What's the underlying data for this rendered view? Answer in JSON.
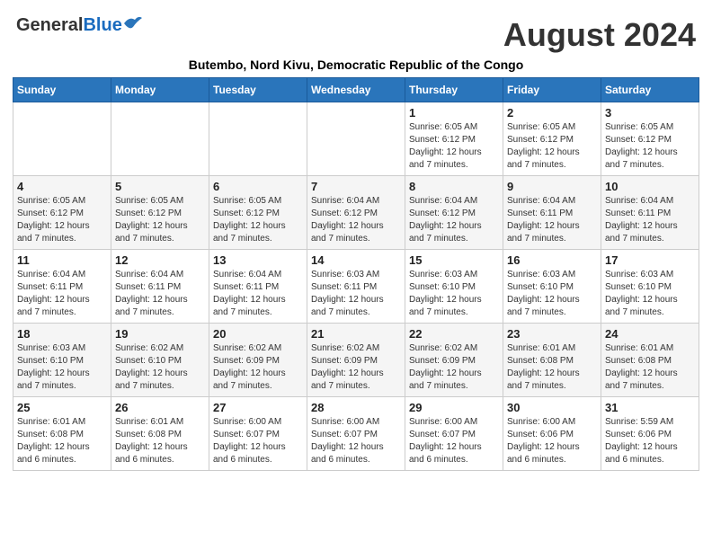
{
  "header": {
    "logo_general": "General",
    "logo_blue": "Blue",
    "month_year": "August 2024",
    "location": "Butembo, Nord Kivu, Democratic Republic of the Congo"
  },
  "days_of_week": [
    "Sunday",
    "Monday",
    "Tuesday",
    "Wednesday",
    "Thursday",
    "Friday",
    "Saturday"
  ],
  "weeks": [
    [
      {
        "day": "",
        "info": ""
      },
      {
        "day": "",
        "info": ""
      },
      {
        "day": "",
        "info": ""
      },
      {
        "day": "",
        "info": ""
      },
      {
        "day": "1",
        "info": "Sunrise: 6:05 AM\nSunset: 6:12 PM\nDaylight: 12 hours\nand 7 minutes."
      },
      {
        "day": "2",
        "info": "Sunrise: 6:05 AM\nSunset: 6:12 PM\nDaylight: 12 hours\nand 7 minutes."
      },
      {
        "day": "3",
        "info": "Sunrise: 6:05 AM\nSunset: 6:12 PM\nDaylight: 12 hours\nand 7 minutes."
      }
    ],
    [
      {
        "day": "4",
        "info": "Sunrise: 6:05 AM\nSunset: 6:12 PM\nDaylight: 12 hours\nand 7 minutes."
      },
      {
        "day": "5",
        "info": "Sunrise: 6:05 AM\nSunset: 6:12 PM\nDaylight: 12 hours\nand 7 minutes."
      },
      {
        "day": "6",
        "info": "Sunrise: 6:05 AM\nSunset: 6:12 PM\nDaylight: 12 hours\nand 7 minutes."
      },
      {
        "day": "7",
        "info": "Sunrise: 6:04 AM\nSunset: 6:12 PM\nDaylight: 12 hours\nand 7 minutes."
      },
      {
        "day": "8",
        "info": "Sunrise: 6:04 AM\nSunset: 6:12 PM\nDaylight: 12 hours\nand 7 minutes."
      },
      {
        "day": "9",
        "info": "Sunrise: 6:04 AM\nSunset: 6:11 PM\nDaylight: 12 hours\nand 7 minutes."
      },
      {
        "day": "10",
        "info": "Sunrise: 6:04 AM\nSunset: 6:11 PM\nDaylight: 12 hours\nand 7 minutes."
      }
    ],
    [
      {
        "day": "11",
        "info": "Sunrise: 6:04 AM\nSunset: 6:11 PM\nDaylight: 12 hours\nand 7 minutes."
      },
      {
        "day": "12",
        "info": "Sunrise: 6:04 AM\nSunset: 6:11 PM\nDaylight: 12 hours\nand 7 minutes."
      },
      {
        "day": "13",
        "info": "Sunrise: 6:04 AM\nSunset: 6:11 PM\nDaylight: 12 hours\nand 7 minutes."
      },
      {
        "day": "14",
        "info": "Sunrise: 6:03 AM\nSunset: 6:11 PM\nDaylight: 12 hours\nand 7 minutes."
      },
      {
        "day": "15",
        "info": "Sunrise: 6:03 AM\nSunset: 6:10 PM\nDaylight: 12 hours\nand 7 minutes."
      },
      {
        "day": "16",
        "info": "Sunrise: 6:03 AM\nSunset: 6:10 PM\nDaylight: 12 hours\nand 7 minutes."
      },
      {
        "day": "17",
        "info": "Sunrise: 6:03 AM\nSunset: 6:10 PM\nDaylight: 12 hours\nand 7 minutes."
      }
    ],
    [
      {
        "day": "18",
        "info": "Sunrise: 6:03 AM\nSunset: 6:10 PM\nDaylight: 12 hours\nand 7 minutes."
      },
      {
        "day": "19",
        "info": "Sunrise: 6:02 AM\nSunset: 6:10 PM\nDaylight: 12 hours\nand 7 minutes."
      },
      {
        "day": "20",
        "info": "Sunrise: 6:02 AM\nSunset: 6:09 PM\nDaylight: 12 hours\nand 7 minutes."
      },
      {
        "day": "21",
        "info": "Sunrise: 6:02 AM\nSunset: 6:09 PM\nDaylight: 12 hours\nand 7 minutes."
      },
      {
        "day": "22",
        "info": "Sunrise: 6:02 AM\nSunset: 6:09 PM\nDaylight: 12 hours\nand 7 minutes."
      },
      {
        "day": "23",
        "info": "Sunrise: 6:01 AM\nSunset: 6:08 PM\nDaylight: 12 hours\nand 7 minutes."
      },
      {
        "day": "24",
        "info": "Sunrise: 6:01 AM\nSunset: 6:08 PM\nDaylight: 12 hours\nand 7 minutes."
      }
    ],
    [
      {
        "day": "25",
        "info": "Sunrise: 6:01 AM\nSunset: 6:08 PM\nDaylight: 12 hours\nand 6 minutes."
      },
      {
        "day": "26",
        "info": "Sunrise: 6:01 AM\nSunset: 6:08 PM\nDaylight: 12 hours\nand 6 minutes."
      },
      {
        "day": "27",
        "info": "Sunrise: 6:00 AM\nSunset: 6:07 PM\nDaylight: 12 hours\nand 6 minutes."
      },
      {
        "day": "28",
        "info": "Sunrise: 6:00 AM\nSunset: 6:07 PM\nDaylight: 12 hours\nand 6 minutes."
      },
      {
        "day": "29",
        "info": "Sunrise: 6:00 AM\nSunset: 6:07 PM\nDaylight: 12 hours\nand 6 minutes."
      },
      {
        "day": "30",
        "info": "Sunrise: 6:00 AM\nSunset: 6:06 PM\nDaylight: 12 hours\nand 6 minutes."
      },
      {
        "day": "31",
        "info": "Sunrise: 5:59 AM\nSunset: 6:06 PM\nDaylight: 12 hours\nand 6 minutes."
      }
    ]
  ]
}
